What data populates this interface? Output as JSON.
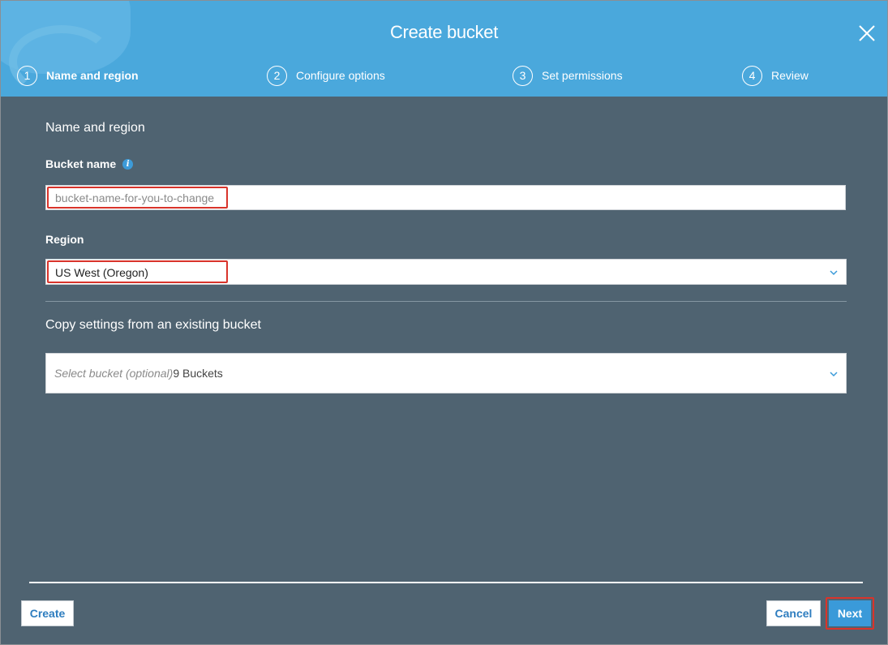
{
  "dialog": {
    "title": "Create bucket"
  },
  "steps": [
    {
      "number": "1",
      "label": "Name and region",
      "active": true
    },
    {
      "number": "2",
      "label": "Configure options",
      "active": false
    },
    {
      "number": "3",
      "label": "Set permissions",
      "active": false
    },
    {
      "number": "4",
      "label": "Review",
      "active": false
    }
  ],
  "form": {
    "section_heading": "Name and region",
    "bucket_name": {
      "label": "Bucket name",
      "placeholder": "bucket-name-for-you-to-change",
      "value": ""
    },
    "region": {
      "label": "Region",
      "selected": "US West (Oregon)"
    },
    "copy_settings": {
      "heading": "Copy settings from an existing bucket",
      "placeholder": "Select bucket (optional)",
      "count_text": "9 Buckets"
    }
  },
  "footer": {
    "create_label": "Create",
    "cancel_label": "Cancel",
    "next_label": "Next"
  },
  "colors": {
    "header": "#4aa8dc",
    "body": "#4f6371",
    "accent": "#3a9ad9",
    "highlight": "#d9342b"
  },
  "icons": {
    "close": "close-icon",
    "info": "info-icon",
    "chevron": "chevron-down-icon"
  }
}
